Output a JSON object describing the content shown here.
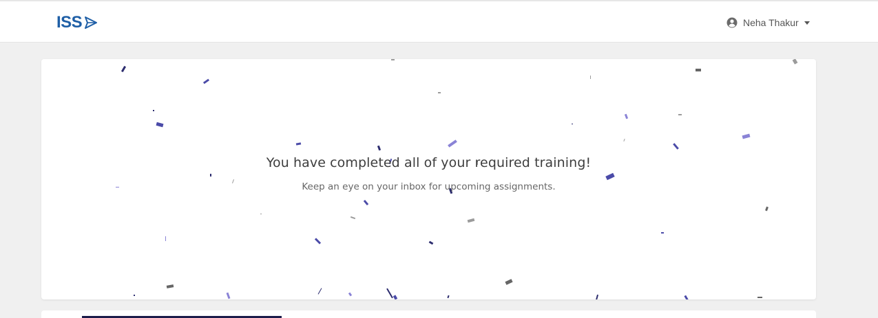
{
  "header": {
    "logo_text": "ISS",
    "brand_color": "#1f5fa6",
    "user": {
      "name": "Neha Thakur",
      "icon": "user-circle-icon"
    }
  },
  "completion_card": {
    "title": "You have completed all of your required training!",
    "subtitle": "Keep an eye on your inbox for upcoming assignments.",
    "confetti_colors": [
      "#4b4ba8",
      "#8a83d6",
      "#2c2c6e",
      "#9b9b9b",
      "#666666"
    ]
  }
}
